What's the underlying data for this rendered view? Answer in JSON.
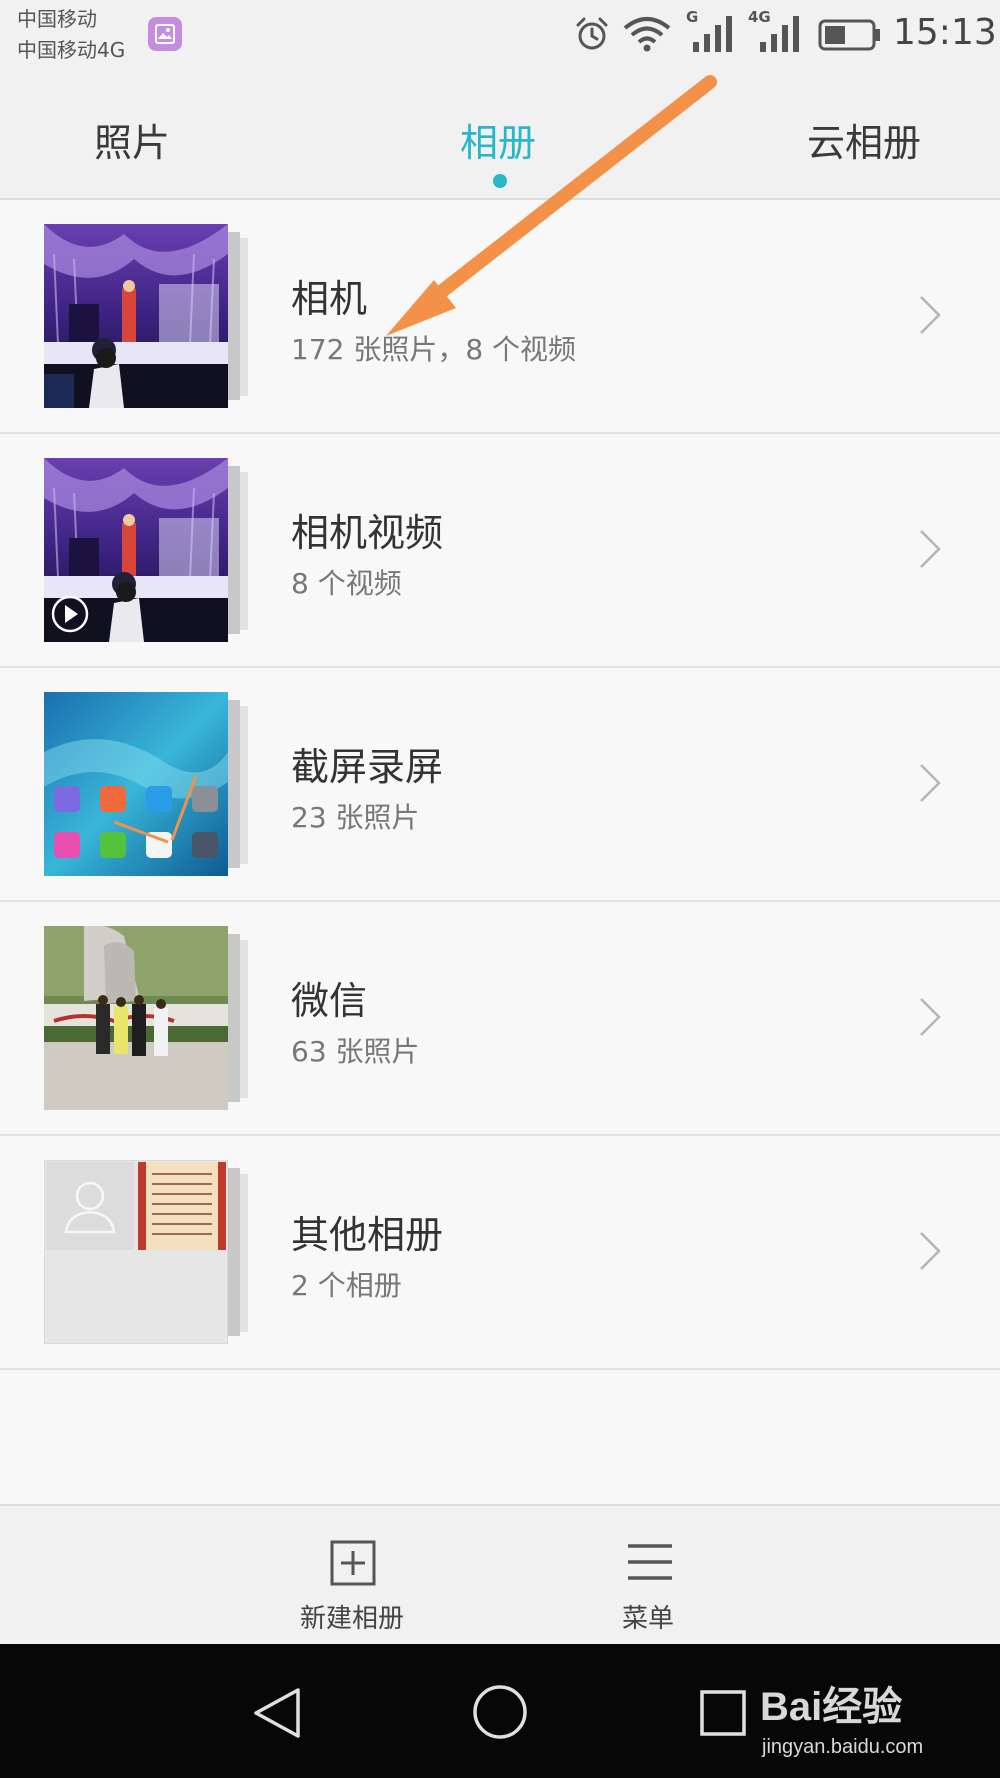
{
  "status_bar": {
    "carrier_1": "中国移动",
    "carrier_2": "中国移动4G",
    "network_1": "G",
    "network_2": "4G",
    "time": "15:13",
    "icons": [
      "gallery-icon",
      "alarm-icon",
      "wifi-icon",
      "signal-icon",
      "battery-icon"
    ]
  },
  "tabs": [
    {
      "label": "照片",
      "active": false
    },
    {
      "label": "相册",
      "active": true
    },
    {
      "label": "云相册",
      "active": false
    }
  ],
  "accent_color": "#29b6c9",
  "albums": [
    {
      "title": "相机",
      "subtitle": "172 张照片，8 个视频"
    },
    {
      "title": "相机视频",
      "subtitle": "8 个视频"
    },
    {
      "title": "截屏录屏",
      "subtitle": "23 张照片"
    },
    {
      "title": "微信",
      "subtitle": "63 张照片"
    },
    {
      "title": "其他相册",
      "subtitle": "2 个相册"
    }
  ],
  "toolbar": {
    "new_album_label": "新建相册",
    "menu_label": "菜单"
  },
  "watermark": {
    "main": "Bai经验",
    "sub": "jingyan.baidu.com"
  },
  "annotation_color": "#f39149"
}
